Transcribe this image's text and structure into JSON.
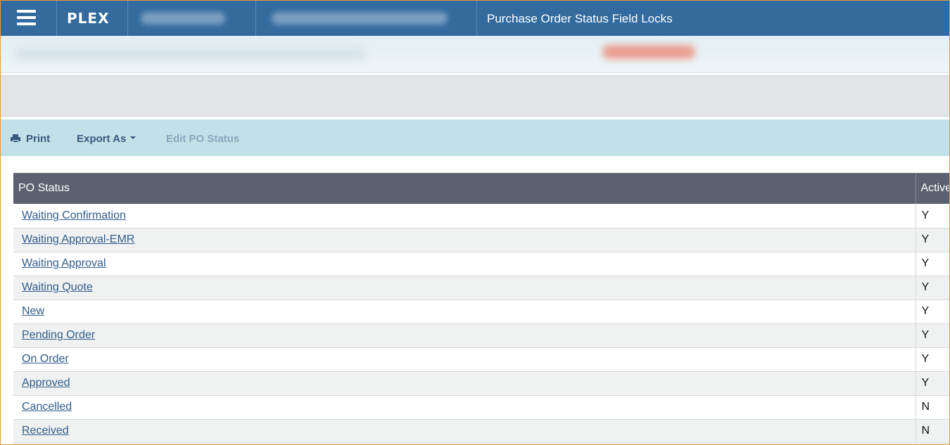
{
  "header": {
    "menu_icon": "hamburger-menu-icon",
    "logo": "PLEX",
    "page_title": "Purchase Order Status Field Locks"
  },
  "toolbar": {
    "print_label": "Print",
    "print_icon": "printer-icon",
    "export_label": "Export As",
    "edit_label": "Edit PO Status"
  },
  "table": {
    "columns": [
      "PO Status",
      "Active"
    ],
    "rows": [
      {
        "status": "Waiting Confirmation",
        "active": "Y"
      },
      {
        "status": "Waiting Approval-EMR",
        "active": "Y"
      },
      {
        "status": "Waiting Approval",
        "active": "Y"
      },
      {
        "status": "Waiting Quote",
        "active": "Y"
      },
      {
        "status": "New",
        "active": "Y"
      },
      {
        "status": "Pending Order",
        "active": "Y"
      },
      {
        "status": "On Order",
        "active": "Y"
      },
      {
        "status": "Approved",
        "active": "Y"
      },
      {
        "status": "Cancelled",
        "active": "N"
      },
      {
        "status": "Received",
        "active": "N"
      }
    ]
  },
  "colors": {
    "topbar": "#336b9f",
    "toolbar": "#c2e0e8",
    "table_header": "#5b616f",
    "link": "#2f5d8c"
  }
}
